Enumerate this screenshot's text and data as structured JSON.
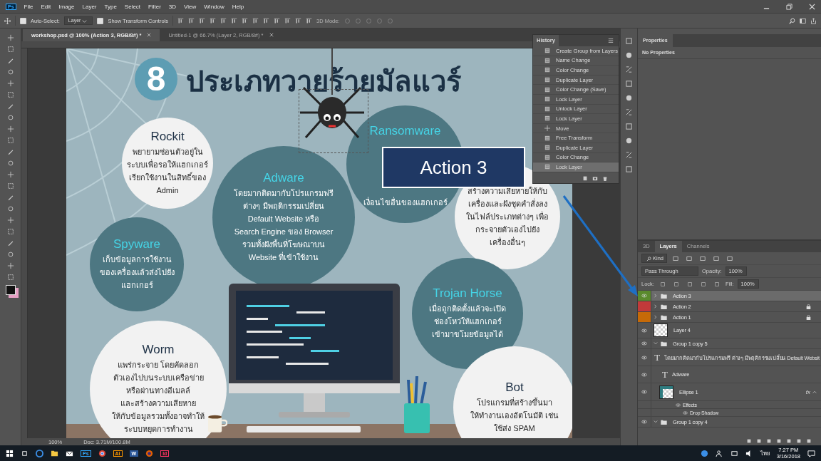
{
  "app_logo": "Ps",
  "menu": [
    "File",
    "Edit",
    "Image",
    "Layer",
    "Type",
    "Select",
    "Filter",
    "3D",
    "View",
    "Window",
    "Help"
  ],
  "options_bar": {
    "auto_select": {
      "label": "Auto-Select:",
      "checked": true
    },
    "target": "Layer",
    "transform_controls": {
      "label": "Show Transform Controls",
      "checked": true
    },
    "mode_3d": "3D Mode:"
  },
  "document_tabs": [
    {
      "label": "workshop.psd @ 100% (Action 3, RGB/8#) *",
      "selected": true
    },
    {
      "label": "Untitled-1 @ 66.7% (Layer 2, RGB/8#) *",
      "selected": false
    }
  ],
  "canvas": {
    "title_number": "8",
    "title": "ประเภทวายร้ายมัลแวร์",
    "circles": [
      {
        "kind": "light",
        "title": "Rockit",
        "body": "พยายามซ่อนตัวอยู่ใน\nระบบเพื่อรอให้แฮกเกอร์\nเรียกใช้งานในสิทธิ์ของ\nAdmin"
      },
      {
        "kind": "dark",
        "title": "Adware",
        "body": "โดยมากติดมากับโปรแกรมฟรี\nต่างๆ มีพฤติกรรมเปลี่ยน\nDefault Website หรือ\nSearch Engine ของ Browser\nรวมทั้งฝังพื้นที่โฆษณาบน\nWebsite ที่เข้าใช้งาน"
      },
      {
        "kind": "dark",
        "title": "Ransomware",
        "body": "เงื่อนไขอื่นของแฮกเกอร์"
      },
      {
        "kind": "light",
        "body": "สร้างความเสียหายให้กับ\nเครื่องและฝังชุดคำสั่งลง\nในไฟล์ประเภทต่างๆ เพื่อ\nกระจายตัวเองไปยัง\nเครื่องอื่นๆ"
      },
      {
        "kind": "dark",
        "title": "Spyware",
        "body": "เก็บข้อมูลการใช้งาน\nของเครื่องแล้วส่งไปยัง\nแฮกเกอร์"
      },
      {
        "kind": "dark",
        "title": "Trojan Horse",
        "body": "เมื่อถูกติดตั้งแล้วจะเปิด\nช่องโหว่ให้แฮกเกอร์\nเข้ามาขโมยข้อมูลได้"
      },
      {
        "kind": "light",
        "title": "Worm",
        "body": "แพร่กระจาย โดยคัดลอก\nตัวเองไปบนระบบเครือข่าย\nหรือผ่านทางอีเมลล์\nและสร้างความเสียหาย\nให้กับข้อมูลรวมทั้งอาจทำให้\nระบบหยุดการทำงาน"
      },
      {
        "kind": "light",
        "title": "Bot",
        "body": "โปรแกรมที่สร้างขึ้นมา\nให้ทำงานเองอัตโนมัติ เช่น\nใช้ส่ง SPAM"
      }
    ]
  },
  "callout": {
    "label": "Action 3"
  },
  "status_bar": {
    "zoom": "100%",
    "doc": "Doc: 3.71M/100.8M"
  },
  "history": {
    "title": "History",
    "items": [
      {
        "label": "Create Group from Layers",
        "kind": "state",
        "selected": false
      },
      {
        "label": "Name Change",
        "kind": "state",
        "selected": false
      },
      {
        "label": "Color Change",
        "kind": "state",
        "selected": false
      },
      {
        "label": "Duplicate Layer",
        "kind": "state",
        "selected": false
      },
      {
        "label": "Color Change (Save)",
        "kind": "state",
        "selected": false
      },
      {
        "label": "Lock Layer",
        "kind": "state",
        "selected": false
      },
      {
        "label": "Unlock Layer",
        "kind": "state",
        "selected": false
      },
      {
        "label": "Lock Layer",
        "kind": "state",
        "selected": false
      },
      {
        "label": "Move",
        "kind": "move",
        "selected": false
      },
      {
        "label": "Free Transform",
        "kind": "state",
        "selected": false
      },
      {
        "label": "Duplicate Layer",
        "kind": "state",
        "selected": false
      },
      {
        "label": "Color Change",
        "kind": "state",
        "selected": false
      },
      {
        "label": "Lock Layer",
        "kind": "state",
        "selected": true
      }
    ]
  },
  "properties": {
    "title": "Properties",
    "message": "No Properties"
  },
  "layers_panel": {
    "tabs": [
      {
        "label": "3D",
        "selected": false
      },
      {
        "label": "Layers",
        "selected": true
      },
      {
        "label": "Channels",
        "selected": false
      }
    ],
    "filter": "Kind",
    "blend_mode": "Pass Through",
    "opacity_label": "Opacity:",
    "opacity": "100%",
    "lock_label": "Lock:",
    "fill_label": "Fill:",
    "fill": "100%",
    "layers": [
      {
        "name": "Action 3",
        "kind": "group",
        "visible": true,
        "color": "#5a8a2c",
        "selected": true,
        "locked": false,
        "expanded": false
      },
      {
        "name": "Action 2",
        "kind": "group",
        "visible": false,
        "color": "#c23a3a",
        "selected": false,
        "locked": true,
        "expanded": false
      },
      {
        "name": "Action 1",
        "kind": "group",
        "visible": false,
        "color": "#c66a08",
        "selected": false,
        "locked": true,
        "expanded": false
      },
      {
        "name": "Layer 4",
        "kind": "pixel",
        "visible": true,
        "selected": false,
        "locked": false
      },
      {
        "name": "Group 1 copy 5",
        "kind": "group",
        "visible": true,
        "selected": false,
        "locked": false,
        "expanded": true,
        "children": [
          {
            "name": "โดยมากติดมากับโปรแกรมฟรี ต่างๆ มีพฤติกรรมเปลี่ยน Default Websit",
            "kind": "text",
            "thumb_label": "T",
            "visible": true,
            "selected": false
          },
          {
            "name": "Adware",
            "kind": "text",
            "thumb_label": "T",
            "visible": true,
            "selected": false
          },
          {
            "name": "Ellipse 1",
            "kind": "shape",
            "badge": "fx",
            "visible": true,
            "selected": false,
            "expanded": true,
            "children": [
              {
                "name": "Effects",
                "kind": "effects",
                "visible": true,
                "selected": false,
                "children": [
                  {
                    "name": "Drop Shadow",
                    "kind": "effect",
                    "visible": true,
                    "selected": false
                  }
                ]
              }
            ]
          }
        ]
      },
      {
        "name": "Group 1 copy 4",
        "kind": "group",
        "visible": true,
        "selected": false,
        "locked": false,
        "expanded": true
      }
    ]
  },
  "taskbar": {
    "apps": [
      {
        "kind": "edge"
      },
      {
        "kind": "folder"
      },
      {
        "kind": "mail"
      },
      {
        "kind": "badge",
        "label": "Ps",
        "color": "#31a8ff"
      },
      {
        "kind": "chrome"
      },
      {
        "kind": "badge",
        "label": "Ai",
        "color": "#ff9a00"
      },
      {
        "kind": "word",
        "label": "W",
        "color": "#2b5797"
      },
      {
        "kind": "firefox"
      },
      {
        "kind": "badge",
        "label": "Id",
        "color": "#ff3366"
      }
    ],
    "language": "ไทย",
    "time": "7:27 PM",
    "date": "3/16/2018"
  }
}
